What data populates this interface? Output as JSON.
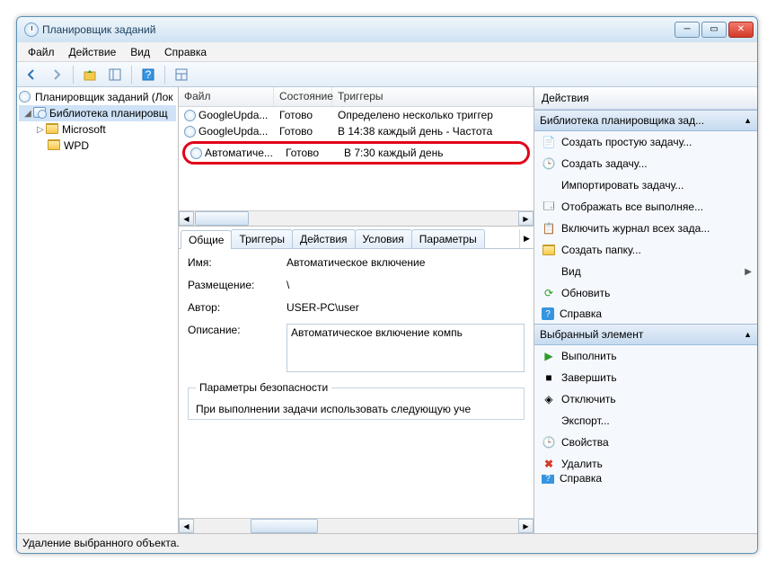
{
  "window": {
    "title": "Планировщик заданий"
  },
  "menu": {
    "file": "Файл",
    "action": "Действие",
    "view": "Вид",
    "help": "Справка"
  },
  "tree": {
    "root": "Планировщик заданий (Лок",
    "lib": "Библиотека планировщ",
    "ms": "Microsoft",
    "wpd": "WPD"
  },
  "columns": {
    "file": "Файл",
    "state": "Состояние",
    "triggers": "Триггеры"
  },
  "tasks": [
    {
      "name": "GoogleUpda...",
      "state": "Готово",
      "trigger": "Определено несколько триггер"
    },
    {
      "name": "GoogleUpda...",
      "state": "Готово",
      "trigger": "В 14:38 каждый день - Частота"
    },
    {
      "name": "Автоматиче...",
      "state": "Готово",
      "trigger": "В 7:30 каждый день"
    }
  ],
  "tabs": {
    "general": "Общие",
    "triggers": "Триггеры",
    "actions": "Действия",
    "conditions": "Условия",
    "params": "Параметры"
  },
  "general": {
    "name_label": "Имя:",
    "name_value": "Автоматическое включение",
    "location_label": "Размещение:",
    "location_value": "\\",
    "author_label": "Автор:",
    "author_value": "USER-PC\\user",
    "desc_label": "Описание:",
    "desc_value": "Автоматическое включение компь",
    "sec_legend": "Параметры безопасности",
    "sec_line": "При выполнении задачи использовать следующую уче"
  },
  "actions_pane": {
    "title": "Действия",
    "group1": "Библиотека планировщика зад...",
    "items1": {
      "create_basic": "Создать простую задачу...",
      "create": "Создать задачу...",
      "import": "Импортировать задачу...",
      "show_running": "Отображать все выполняе...",
      "enable_history": "Включить журнал всех зада...",
      "new_folder": "Создать папку...",
      "view": "Вид",
      "refresh": "Обновить",
      "help": "Справка"
    },
    "group2": "Выбранный элемент",
    "items2": {
      "run": "Выполнить",
      "end": "Завершить",
      "disable": "Отключить",
      "export": "Экспорт...",
      "properties": "Свойства",
      "delete": "Удалить",
      "help": "Справка"
    }
  },
  "statusbar": "Удаление выбранного объекта."
}
